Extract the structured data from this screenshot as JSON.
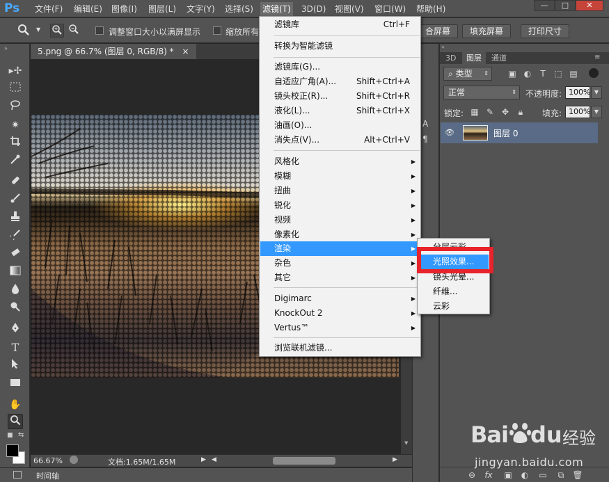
{
  "app": {
    "logo": "Ps"
  },
  "menubar": {
    "items": [
      "文件(F)",
      "编辑(E)",
      "图像(I)",
      "图层(L)",
      "文字(Y)",
      "选择(S)",
      "滤镜(T)",
      "3D(D)",
      "视图(V)",
      "窗口(W)",
      "帮助(H)"
    ],
    "active_index": 6,
    "window_controls": [
      "—",
      "□",
      "✕"
    ]
  },
  "options_bar": {
    "resize_windows_label": "调整窗口大小以满屏显示",
    "zoom_all_label": "缩放所有",
    "fit_screen_label": "合屏幕",
    "fill_screen_label": "填充屏幕",
    "print_size_label": "打印尺寸"
  },
  "document": {
    "tab_title": "5.png @ 66.7% (图层 0, RGB/8) *",
    "tab_close": "×",
    "zoom": "66.67%",
    "doc_size": "文档:1.65M/1.65M"
  },
  "timeline": {
    "label": "时间轴"
  },
  "filter_menu": {
    "items": [
      {
        "label": "滤镜库",
        "shortcut": "Ctrl+F"
      },
      {
        "label": "转换为智能滤镜"
      },
      {
        "label": "滤镜库(G)..."
      },
      {
        "label": "自适应广角(A)...",
        "shortcut": "Shift+Ctrl+A"
      },
      {
        "label": "镜头校正(R)...",
        "shortcut": "Shift+Ctrl+R"
      },
      {
        "label": "液化(L)...",
        "shortcut": "Shift+Ctrl+X"
      },
      {
        "label": "油画(O)..."
      },
      {
        "label": "消失点(V)...",
        "shortcut": "Alt+Ctrl+V"
      },
      {
        "label": "风格化",
        "submenu": true
      },
      {
        "label": "模糊",
        "submenu": true
      },
      {
        "label": "扭曲",
        "submenu": true
      },
      {
        "label": "锐化",
        "submenu": true
      },
      {
        "label": "视频",
        "submenu": true
      },
      {
        "label": "像素化",
        "submenu": true
      },
      {
        "label": "渲染",
        "submenu": true,
        "highlighted": true
      },
      {
        "label": "杂色",
        "submenu": true
      },
      {
        "label": "其它",
        "submenu": true
      },
      {
        "label": "Digimarc",
        "submenu": true
      },
      {
        "label": "KnockOut 2",
        "submenu": true
      },
      {
        "label": "Vertus™",
        "submenu": true
      },
      {
        "label": "浏览联机滤镜..."
      }
    ]
  },
  "render_submenu": {
    "items": [
      "分层云彩",
      "光照效果...",
      "镜头光晕...",
      "纤维...",
      "云彩"
    ],
    "highlighted_index": 1
  },
  "layers_panel": {
    "tabs": [
      "3D",
      "图层",
      "通道"
    ],
    "active_tab": 1,
    "filter_kind": "类型",
    "blend_mode": "正常",
    "opacity_label": "不透明度:",
    "opacity_value": "100%",
    "lock_label": "锁定:",
    "fill_label": "填充:",
    "fill_value": "100%",
    "layer_name": "图层 0",
    "bottom_icons": [
      "link-icon",
      "fx-icon",
      "mask-icon",
      "adjustment-icon",
      "group-icon",
      "new-layer-icon",
      "trash-icon"
    ]
  },
  "watermark": {
    "brand_a": "Bai",
    "brand_b": "du",
    "brand_c": "经验",
    "url": "jingyan.baidu.com"
  },
  "colors": {
    "highlight": "#3399ff",
    "red_box": "#e8232b",
    "ui_gray": "#535353",
    "canvas": "#282828",
    "selected_layer": "#596b86"
  }
}
